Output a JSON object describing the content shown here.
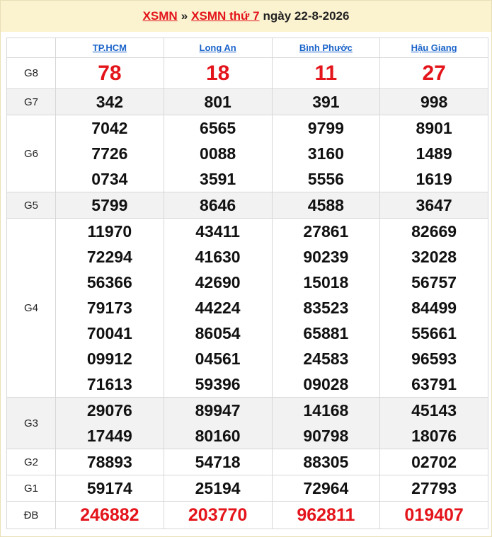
{
  "header": {
    "link1": "XSMN",
    "separator": "»",
    "link2": "XSMN thứ 7",
    "date_text": "ngày 22-8-2026"
  },
  "provinces": [
    "TP.HCM",
    "Long An",
    "Bình Phước",
    "Hậu Giang"
  ],
  "prizes": {
    "g8": {
      "label": "G8",
      "values": [
        "78",
        "18",
        "11",
        "27"
      ]
    },
    "g7": {
      "label": "G7",
      "values": [
        "342",
        "801",
        "391",
        "998"
      ]
    },
    "g6": {
      "label": "G6",
      "values": [
        [
          "7042",
          "7726",
          "0734"
        ],
        [
          "6565",
          "0088",
          "3591"
        ],
        [
          "9799",
          "3160",
          "5556"
        ],
        [
          "8901",
          "1489",
          "1619"
        ]
      ]
    },
    "g5": {
      "label": "G5",
      "values": [
        "5799",
        "8646",
        "4588",
        "3647"
      ]
    },
    "g4": {
      "label": "G4",
      "values": [
        [
          "11970",
          "72294",
          "56366",
          "79173",
          "70041",
          "09912",
          "71613"
        ],
        [
          "43411",
          "41630",
          "42690",
          "44224",
          "86054",
          "04561",
          "59396"
        ],
        [
          "27861",
          "90239",
          "15018",
          "83523",
          "65881",
          "24583",
          "09028"
        ],
        [
          "82669",
          "32028",
          "56757",
          "84499",
          "55661",
          "96593",
          "63791"
        ]
      ]
    },
    "g3": {
      "label": "G3",
      "values": [
        [
          "29076",
          "17449"
        ],
        [
          "89947",
          "80160"
        ],
        [
          "14168",
          "90798"
        ],
        [
          "45143",
          "18076"
        ]
      ]
    },
    "g2": {
      "label": "G2",
      "values": [
        "78893",
        "54718",
        "88305",
        "02702"
      ]
    },
    "g1": {
      "label": "G1",
      "values": [
        "59174",
        "25194",
        "72964",
        "27793"
      ]
    },
    "db": {
      "label": "ĐB",
      "values": [
        "246882",
        "203770",
        "962811",
        "019407"
      ]
    }
  },
  "colors": {
    "accent_red": "#e4141b",
    "link_blue": "#1a63c9",
    "header_bg": "#fbf3d0",
    "alt_row": "#f2f2f2"
  }
}
